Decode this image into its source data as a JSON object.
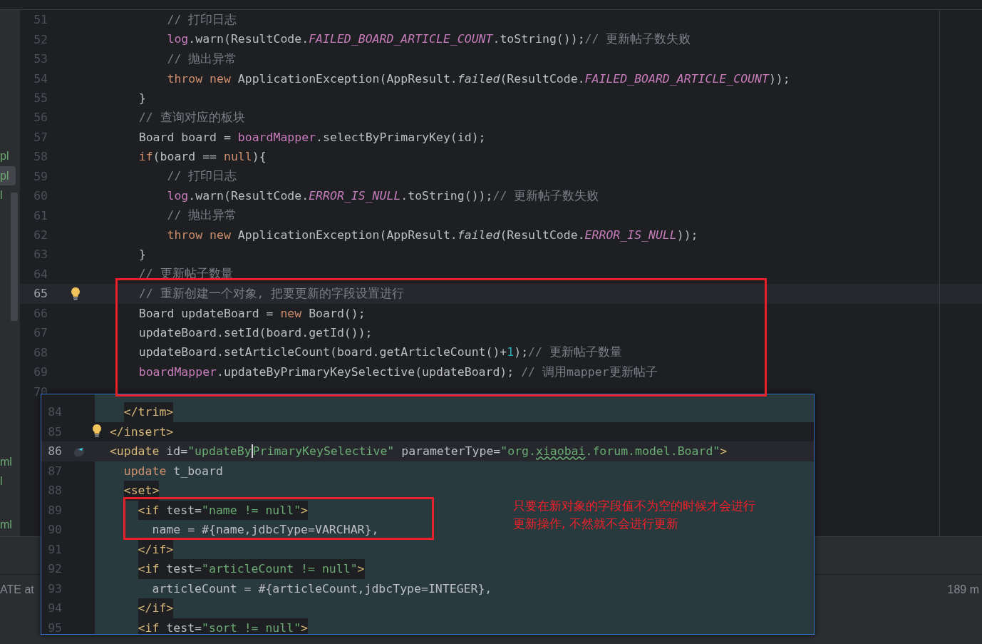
{
  "sidebar": {
    "items": [
      {
        "label": "pl",
        "selected": false
      },
      {
        "label": "pl",
        "selected": true
      },
      {
        "label": "l",
        "selected": false
      },
      {
        "label": "ml",
        "selected": false
      },
      {
        "label": "l",
        "selected": false
      },
      {
        "label": "ml",
        "selected": false
      }
    ]
  },
  "editor": {
    "lines": [
      {
        "num": "51",
        "current": false,
        "tokens": [
          {
            "kind": "c",
            "text": "        // 打印日志"
          }
        ]
      },
      {
        "num": "52",
        "current": false,
        "tokens": [
          {
            "kind": "f",
            "text": "        log"
          },
          {
            "kind": "p",
            "text": ".warn(ResultCode."
          },
          {
            "kind": "i",
            "text": "FAILED_BOARD_ARTICLE_COUNT"
          },
          {
            "kind": "p",
            "text": ".toString());"
          },
          {
            "kind": "c",
            "text": "// 更新帖子数失败"
          }
        ]
      },
      {
        "num": "53",
        "current": false,
        "tokens": [
          {
            "kind": "c",
            "text": "        // 抛出异常"
          }
        ]
      },
      {
        "num": "54",
        "current": false,
        "tokens": [
          {
            "kind": "k",
            "text": "        throw new "
          },
          {
            "kind": "p",
            "text": "ApplicationException(AppResult."
          },
          {
            "kind": "m",
            "text": "failed"
          },
          {
            "kind": "p",
            "text": "(ResultCode."
          },
          {
            "kind": "i",
            "text": "FAILED_BOARD_ARTICLE_COUNT"
          },
          {
            "kind": "p",
            "text": "));"
          }
        ]
      },
      {
        "num": "55",
        "current": false,
        "tokens": [
          {
            "kind": "p",
            "text": "    }"
          }
        ]
      },
      {
        "num": "56",
        "current": false,
        "tokens": [
          {
            "kind": "c",
            "text": "    // 查询对应的板块"
          }
        ]
      },
      {
        "num": "57",
        "current": false,
        "tokens": [
          {
            "kind": "p",
            "text": "    Board board = "
          },
          {
            "kind": "f",
            "text": "boardMapper"
          },
          {
            "kind": "p",
            "text": ".selectByPrimaryKey(id);"
          }
        ]
      },
      {
        "num": "58",
        "current": false,
        "tokens": [
          {
            "kind": "k",
            "text": "    if"
          },
          {
            "kind": "p",
            "text": "(board == "
          },
          {
            "kind": "k",
            "text": "null"
          },
          {
            "kind": "p",
            "text": "){"
          }
        ]
      },
      {
        "num": "59",
        "current": false,
        "tokens": [
          {
            "kind": "c",
            "text": "        // 打印日志"
          }
        ]
      },
      {
        "num": "60",
        "current": false,
        "tokens": [
          {
            "kind": "f",
            "text": "        log"
          },
          {
            "kind": "p",
            "text": ".warn(ResultCode."
          },
          {
            "kind": "i",
            "text": "ERROR_IS_NULL"
          },
          {
            "kind": "p",
            "text": ".toString());"
          },
          {
            "kind": "c",
            "text": "// 更新帖子数失败"
          }
        ]
      },
      {
        "num": "61",
        "current": false,
        "tokens": [
          {
            "kind": "c",
            "text": "        // 抛出异常"
          }
        ]
      },
      {
        "num": "62",
        "current": false,
        "tokens": [
          {
            "kind": "k",
            "text": "        throw new "
          },
          {
            "kind": "p",
            "text": "ApplicationException(AppResult."
          },
          {
            "kind": "m",
            "text": "failed"
          },
          {
            "kind": "p",
            "text": "(ResultCode."
          },
          {
            "kind": "i",
            "text": "ERROR_IS_NULL"
          },
          {
            "kind": "p",
            "text": "));"
          }
        ]
      },
      {
        "num": "63",
        "current": false,
        "tokens": [
          {
            "kind": "p",
            "text": "    }"
          }
        ]
      },
      {
        "num": "64",
        "current": false,
        "tokens": [
          {
            "kind": "c",
            "text": "    // 更新帖子数量"
          }
        ]
      },
      {
        "num": "65",
        "current": true,
        "tokens": [
          {
            "kind": "c",
            "text": "    // 重新创建一个对象, 把要更新的字段设置进行"
          }
        ]
      },
      {
        "num": "66",
        "current": false,
        "tokens": [
          {
            "kind": "p",
            "text": "    Board updateBoard = "
          },
          {
            "kind": "k",
            "text": "new "
          },
          {
            "kind": "p",
            "text": "Board();"
          }
        ]
      },
      {
        "num": "67",
        "current": false,
        "tokens": [
          {
            "kind": "p",
            "text": "    updateBoard.setId(board.getId());"
          }
        ]
      },
      {
        "num": "68",
        "current": false,
        "tokens": [
          {
            "kind": "p",
            "text": "    updateBoard.setArticleCount(board.getArticleCount()+"
          },
          {
            "kind": "n",
            "text": "1"
          },
          {
            "kind": "p",
            "text": ");"
          },
          {
            "kind": "c",
            "text": "// 更新帖子数量"
          }
        ]
      },
      {
        "num": "69",
        "current": false,
        "tokens": [
          {
            "kind": "f",
            "text": "    boardMapper"
          },
          {
            "kind": "p",
            "text": ".updateByPrimaryKeySelective(updateBoard); "
          },
          {
            "kind": "c",
            "text": "// 调用mapper更新帖子"
          }
        ]
      },
      {
        "num": "70",
        "current": false
      }
    ]
  },
  "popup": {
    "lines": [
      {
        "num": "84",
        "shaded": false,
        "caret_line": false,
        "boxed": true,
        "tokens": [
          {
            "kind": "t",
            "text": "    </trim>"
          }
        ]
      },
      {
        "num": "85",
        "shaded": true,
        "caret_line": false,
        "tokens": [
          {
            "kind": "t",
            "text": "  </insert>"
          }
        ]
      },
      {
        "num": "86",
        "shaded": false,
        "caret_line": true,
        "boxed": false,
        "tokens": [
          {
            "kind": "t",
            "text": "  <update "
          },
          {
            "kind": "p",
            "text": "id="
          },
          {
            "kind": "s",
            "text": "\"updateBy"
          },
          {
            "kind": "sc",
            "text": "PrimaryKeySelective\""
          },
          {
            "kind": "p",
            "text": " parameterType="
          },
          {
            "kind": "s",
            "text": "\"org."
          },
          {
            "kind": "u",
            "text": "xiaobai"
          },
          {
            "kind": "s",
            "text": ".forum.model.Board\""
          },
          {
            "kind": "t",
            "text": ">"
          }
        ]
      },
      {
        "num": "87",
        "shaded": false,
        "caret_line": false,
        "boxed": false,
        "tokens": [
          {
            "kind": "k",
            "text": "    update "
          },
          {
            "kind": "p",
            "text": "t_board"
          }
        ]
      },
      {
        "num": "88",
        "shaded": false,
        "caret_line": false,
        "boxed": true,
        "tokens": [
          {
            "kind": "t",
            "text": "    <set>"
          }
        ]
      },
      {
        "num": "89",
        "shaded": false,
        "caret_line": false,
        "boxed": true,
        "tokens": [
          {
            "kind": "t",
            "text": "      <if "
          },
          {
            "kind": "p",
            "text": "test="
          },
          {
            "kind": "s",
            "text": "\"name != null\""
          },
          {
            "kind": "t",
            "text": ">"
          }
        ]
      },
      {
        "num": "90",
        "shaded": false,
        "caret_line": false,
        "boxed": false,
        "tokens": [
          {
            "kind": "p",
            "text": "        name = #{name,jdbcType=VARCHAR},"
          }
        ]
      },
      {
        "num": "91",
        "shaded": false,
        "caret_line": false,
        "boxed": true,
        "tokens": [
          {
            "kind": "t",
            "text": "      </if>"
          }
        ]
      },
      {
        "num": "92",
        "shaded": false,
        "caret_line": false,
        "boxed": true,
        "tokens": [
          {
            "kind": "t",
            "text": "      <if "
          },
          {
            "kind": "p",
            "text": "test="
          },
          {
            "kind": "s",
            "text": "\"articleCount != null\""
          },
          {
            "kind": "t",
            "text": ">"
          }
        ]
      },
      {
        "num": "93",
        "shaded": false,
        "caret_line": false,
        "boxed": false,
        "tokens": [
          {
            "kind": "p",
            "text": "        articleCount = #{articleCount,jdbcType=INTEGER},"
          }
        ]
      },
      {
        "num": "94",
        "shaded": false,
        "caret_line": false,
        "boxed": true,
        "tokens": [
          {
            "kind": "t",
            "text": "      </if>"
          }
        ]
      },
      {
        "num": "95",
        "shaded": false,
        "caret_line": false,
        "boxed": true,
        "tokens": [
          {
            "kind": "t",
            "text": "      <if "
          },
          {
            "kind": "p",
            "text": "test="
          },
          {
            "kind": "s",
            "text": "\"sort != null\""
          },
          {
            "kind": "t",
            "text": ">"
          }
        ]
      }
    ]
  },
  "annotation": {
    "lines": [
      "只要在新对象的字段值不为空的时候才会进行",
      "更新操作, 不然就不会进行更新"
    ]
  },
  "bottom_panel": {
    "left_text": "ATE at",
    "right_text": "189 m"
  }
}
